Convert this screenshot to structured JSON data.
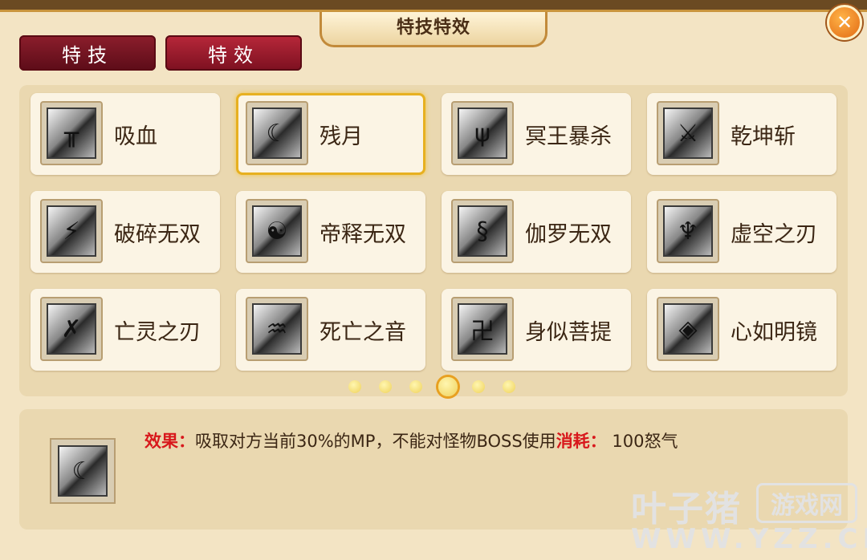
{
  "window": {
    "title": "特技特效",
    "close_glyph": "✕"
  },
  "tabs": [
    {
      "label": "特技",
      "active": true
    },
    {
      "label": "特效",
      "active": false
    }
  ],
  "skills": [
    {
      "name": "吸血",
      "icon": "fork-rune-icon",
      "glyph": "╥",
      "selected": false
    },
    {
      "name": "残月",
      "icon": "crescent-shield-icon",
      "glyph": "☾",
      "selected": true
    },
    {
      "name": "冥王暴杀",
      "icon": "claw-rune-icon",
      "glyph": "ψ",
      "selected": false
    },
    {
      "name": "乾坤斩",
      "icon": "slash-rune-icon",
      "glyph": "⚔",
      "selected": false
    },
    {
      "name": "破碎无双",
      "icon": "shatter-rune-icon",
      "glyph": "⚡",
      "selected": false
    },
    {
      "name": "帝释无双",
      "icon": "yin-yang-rune-icon",
      "glyph": "☯",
      "selected": false
    },
    {
      "name": "伽罗无双",
      "icon": "serpent-rune-icon",
      "glyph": "§",
      "selected": false
    },
    {
      "name": "虚空之刃",
      "icon": "void-blade-icon",
      "glyph": "♆",
      "selected": false
    },
    {
      "name": "亡灵之刃",
      "icon": "undead-blade-icon",
      "glyph": "✗",
      "selected": false
    },
    {
      "name": "死亡之音",
      "icon": "death-sound-icon",
      "glyph": "♒",
      "selected": false
    },
    {
      "name": "身似菩提",
      "icon": "bodhi-rune-icon",
      "glyph": "卍",
      "selected": false
    },
    {
      "name": "心如明镜",
      "icon": "mirror-shield-icon",
      "glyph": "◈",
      "selected": false
    }
  ],
  "pagination": {
    "total": 6,
    "current": 4
  },
  "detail": {
    "icon": "crescent-shield-icon",
    "glyph": "☾",
    "effect_label": "效果：",
    "effect_text": "吸取对方当前30%的MP，不能对怪物BOSS使用",
    "cost_label": "消耗：",
    "cost_text": " 100怒气"
  },
  "watermark": {
    "main": "叶子猪",
    "badge": "游戏网",
    "url": "WWW.YZZ.CN"
  },
  "colors": {
    "accent_gold": "#e7b020",
    "tab_red": "#8c1e2c",
    "effect_red": "#d8181c"
  }
}
